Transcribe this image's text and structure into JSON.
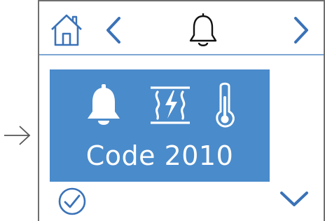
{
  "alert": {
    "code_text": "Code 2010",
    "icons": [
      "bell-icon",
      "heater-warning-icon",
      "thermometer-icon"
    ]
  },
  "top_bar": {
    "icons": [
      "home-icon",
      "chevron-left-icon",
      "bell-outline-icon",
      "chevron-right-icon"
    ]
  },
  "bottom_bar": {
    "icons": [
      "check-circle-icon",
      "chevron-down-icon"
    ]
  },
  "colors": {
    "accent": "#4a8bcb",
    "divider": "#7ea7d4",
    "frame": "#6f6f6f",
    "icon_blue": "#3a72b8",
    "text_on_accent": "#ffffff"
  }
}
